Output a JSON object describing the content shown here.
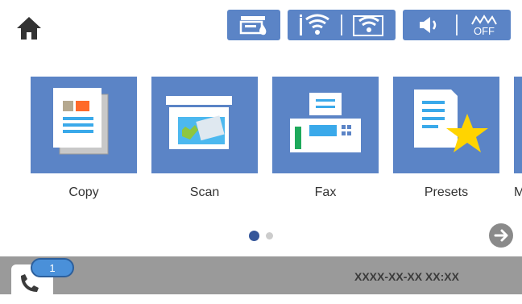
{
  "colors": {
    "tile_blue": "#5b84c6",
    "dot_active": "#35569a",
    "dot_inactive": "#cccccc",
    "bar_gray": "#9a9a9a",
    "badge_blue": "#4a90d9",
    "star_yellow": "#ffd400"
  },
  "header": {
    "home_icon": "home-icon",
    "status_icons": [
      "ink-status-icon",
      "wifi-status-icon",
      "wifi-direct-status-icon",
      "sound-icon",
      "quiet-mode-off-icon"
    ],
    "quiet_label": "OFF"
  },
  "tiles": [
    {
      "label": "Copy",
      "icon": "copy-icon"
    },
    {
      "label": "Scan",
      "icon": "scan-icon"
    },
    {
      "label": "Fax",
      "icon": "fax-icon"
    },
    {
      "label": "Presets",
      "icon": "presets-icon"
    },
    {
      "label": "M",
      "icon": "more-icon"
    }
  ],
  "pagination": {
    "current": 1,
    "total": 2
  },
  "bottom_bar": {
    "job_badge": "1",
    "datetime": "XXXX-XX-XX XX:XX"
  }
}
